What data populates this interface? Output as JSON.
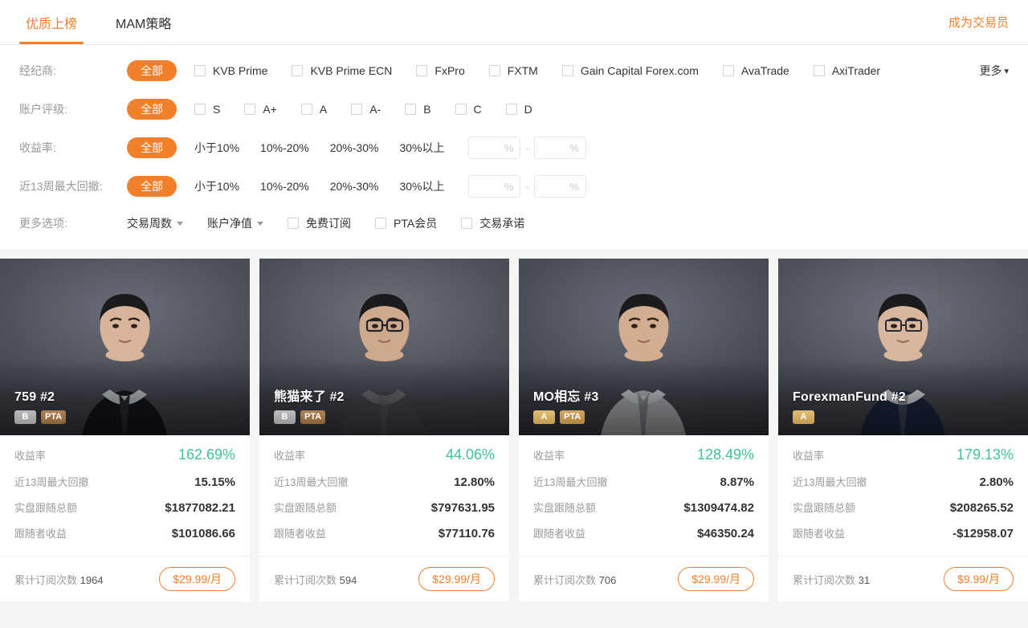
{
  "header": {
    "tabs": [
      {
        "label": "优质上榜",
        "active": true
      },
      {
        "label": "MAM策略",
        "active": false
      }
    ],
    "become_trader": "成为交易员"
  },
  "filters": {
    "broker": {
      "label": "经纪商:",
      "all": "全部",
      "options": [
        "KVB Prime",
        "KVB Prime ECN",
        "FxPro",
        "FXTM",
        "Gain Capital Forex.com",
        "AvaTrade",
        "AxiTrader"
      ],
      "more": "更多"
    },
    "rating": {
      "label": "账户评级:",
      "all": "全部",
      "options": [
        "S",
        "A+",
        "A",
        "A-",
        "B",
        "C",
        "D"
      ]
    },
    "yield": {
      "label": "收益率:",
      "all": "全部",
      "options": [
        "小于10%",
        "10%-20%",
        "20%-30%",
        "30%以上"
      ],
      "min_placeholder": "%",
      "max_placeholder": "%",
      "min_value": "",
      "max_value": "",
      "separator": "-"
    },
    "drawdown": {
      "label": "近13周最大回撤:",
      "all": "全部",
      "options": [
        "小于10%",
        "10%-20%",
        "20%-30%",
        "30%以上"
      ],
      "min_placeholder": "%",
      "max_placeholder": "%",
      "min_value": "",
      "max_value": "",
      "separator": "-"
    },
    "more_options": {
      "label": "更多选项:",
      "selects": [
        "交易周数",
        "账户净值"
      ],
      "checkboxes": [
        "免费订阅",
        "PTA会员",
        "交易承诺"
      ]
    }
  },
  "card_labels": {
    "yield": "收益率",
    "drawdown": "近13周最大回撤",
    "total_follow": "实盘跟随总额",
    "follower_profit": "跟随者收益",
    "subscriptions": "累计订阅次数"
  },
  "cards": [
    {
      "name": "759 #2",
      "badges": [
        {
          "text": "B",
          "style": "gray"
        },
        {
          "text": "PTA",
          "style": "pta-bronze"
        }
      ],
      "yield": "162.69%",
      "drawdown": "15.15%",
      "total_follow": "$1877082.21",
      "follower_profit": "$101086.66",
      "subscriptions": "1964",
      "price": "$29.99/月"
    },
    {
      "name": "熊猫来了 #2",
      "badges": [
        {
          "text": "B",
          "style": "gray"
        },
        {
          "text": "PTA",
          "style": "pta-bronze"
        }
      ],
      "yield": "44.06%",
      "drawdown": "12.80%",
      "total_follow": "$797631.95",
      "follower_profit": "$77110.76",
      "subscriptions": "594",
      "price": "$29.99/月"
    },
    {
      "name": "MO相忘 #3",
      "badges": [
        {
          "text": "A",
          "style": "gold"
        },
        {
          "text": "PTA",
          "style": "pta-gold"
        }
      ],
      "yield": "128.49%",
      "drawdown": "8.87%",
      "total_follow": "$1309474.82",
      "follower_profit": "$46350.24",
      "subscriptions": "706",
      "price": "$29.99/月"
    },
    {
      "name": "ForexmanFund #2",
      "badges": [
        {
          "text": "A",
          "style": "gold"
        }
      ],
      "yield": "179.13%",
      "drawdown": "2.80%",
      "total_follow": "$208265.52",
      "follower_profit": "-$12958.07",
      "subscriptions": "31",
      "price": "$9.99/月"
    }
  ],
  "colors": {
    "accent": "#f2802b",
    "positive": "#3fc29a",
    "page_bg": "#f5f5f5"
  }
}
